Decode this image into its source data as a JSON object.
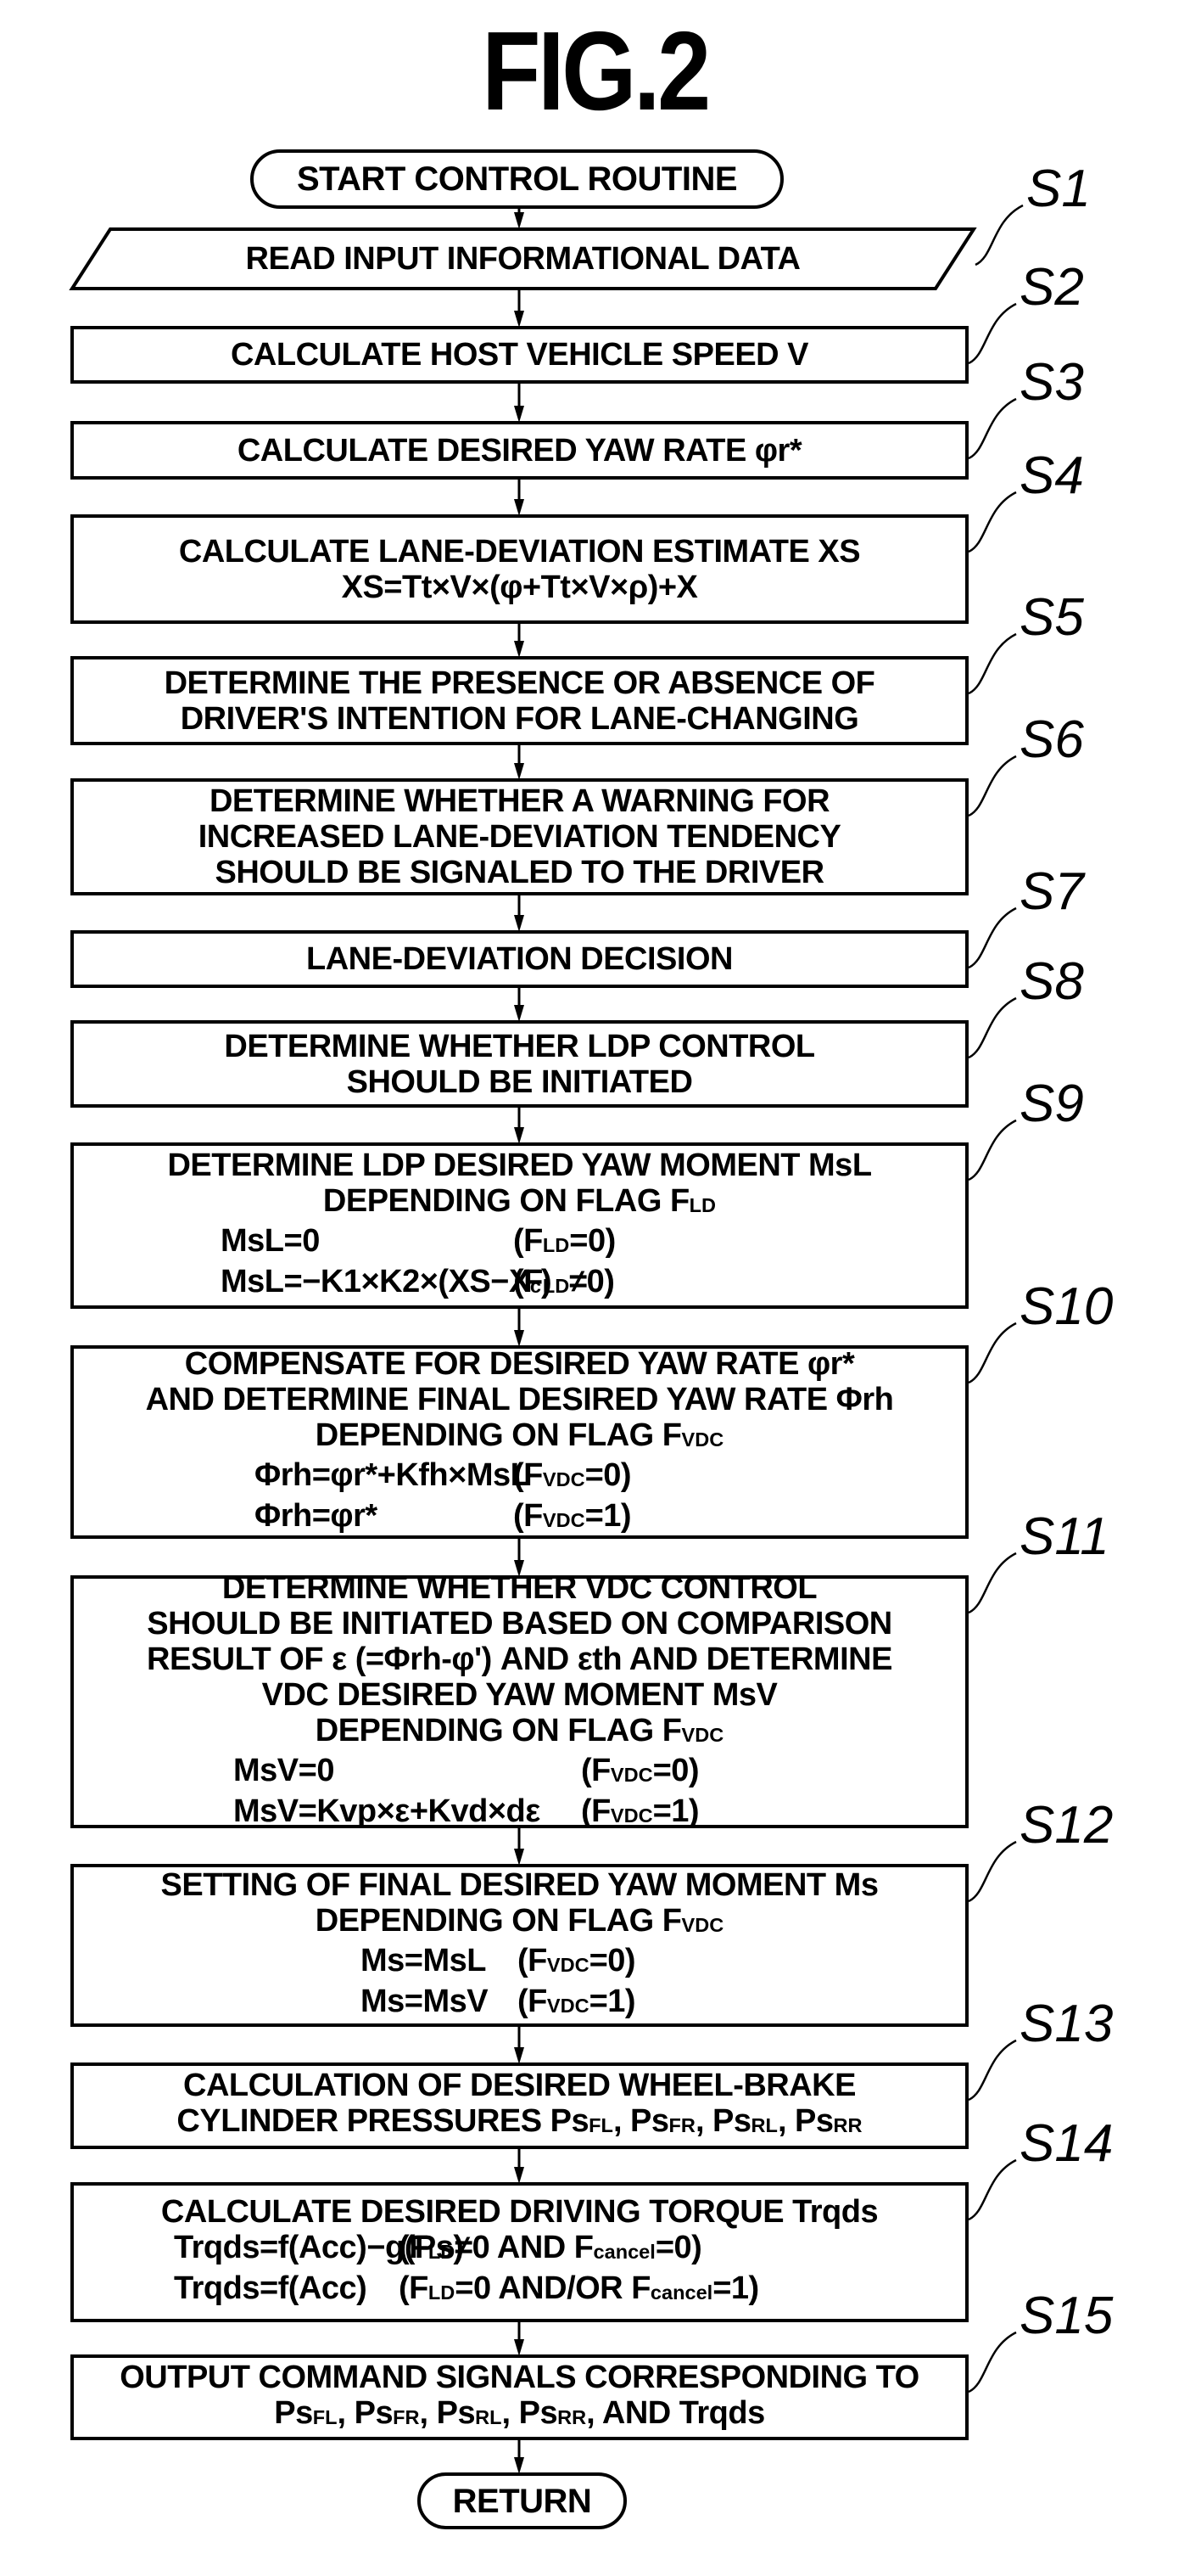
{
  "figure": {
    "title": "FIG.2"
  },
  "flowchart": {
    "start": "START CONTROL ROUTINE",
    "end": "RETURN",
    "steps": [
      {
        "id": "S1",
        "shape": "parallelogram",
        "lines": [
          "READ INPUT INFORMATIONAL DATA"
        ]
      },
      {
        "id": "S2",
        "shape": "rect",
        "lines": [
          "CALCULATE HOST VEHICLE SPEED V"
        ]
      },
      {
        "id": "S3",
        "shape": "rect",
        "lines": [
          "CALCULATE DESIRED YAW RATE φr*"
        ]
      },
      {
        "id": "S4",
        "shape": "rect",
        "lines": [
          "CALCULATE LANE-DEVIATION ESTIMATE XS",
          "XS=Tt×V×(φ+Tt×V×ρ)+X"
        ]
      },
      {
        "id": "S5",
        "shape": "rect",
        "lines": [
          "DETERMINE THE PRESENCE OR ABSENCE OF",
          "DRIVER'S INTENTION FOR LANE-CHANGING"
        ]
      },
      {
        "id": "S6",
        "shape": "rect",
        "lines": [
          "DETERMINE WHETHER A WARNING FOR",
          "INCREASED LANE-DEVIATION TENDENCY",
          "SHOULD BE SIGNALED TO THE DRIVER"
        ]
      },
      {
        "id": "S7",
        "shape": "rect",
        "lines": [
          "LANE-DEVIATION DECISION"
        ]
      },
      {
        "id": "S8",
        "shape": "rect",
        "lines": [
          "DETERMINE WHETHER LDP CONTROL",
          "SHOULD BE INITIATED"
        ]
      },
      {
        "id": "S9",
        "shape": "rect",
        "lines": [
          "DETERMINE LDP DESIRED YAW MOMENT MsL",
          "DEPENDING ON FLAG F_LD"
        ],
        "equations": [
          {
            "lhs": "MsL=0",
            "cond": "(F_LD=0)"
          },
          {
            "lhs": "MsL=−K1×K2×(XS−X_c)",
            "cond": "(F_LD≠0)"
          }
        ]
      },
      {
        "id": "S10",
        "shape": "rect",
        "lines": [
          "COMPENSATE FOR DESIRED YAW RATE φr*",
          "AND DETERMINE FINAL DESIRED YAW RATE Φrh",
          "DEPENDING ON FLAG F_VDC"
        ],
        "equations": [
          {
            "lhs": "Φrh=φr*+Kfh×MsL",
            "cond": "(F_VDC=0)"
          },
          {
            "lhs": "Φrh=φr*",
            "cond": "(F_VDC=1)"
          }
        ]
      },
      {
        "id": "S11",
        "shape": "rect",
        "lines": [
          "DETERMINE WHETHER VDC CONTROL",
          "SHOULD BE INITIATED BASED ON COMPARISON",
          "RESULT OF ε (=Φrh-φ') AND εth AND DETERMINE",
          "VDC DESIRED YAW MOMENT MsV",
          "DEPENDING ON FLAG F_VDC"
        ],
        "equations": [
          {
            "lhs": "MsV=0",
            "cond": "(F_VDC=0)"
          },
          {
            "lhs": "MsV=Kvp×ε+Kvd×dε",
            "cond": "(F_VDC=1)"
          }
        ]
      },
      {
        "id": "S12",
        "shape": "rect",
        "lines": [
          "SETTING OF FINAL DESIRED YAW MOMENT Ms",
          "DEPENDING ON FLAG F_VDC"
        ],
        "equations": [
          {
            "lhs": "Ms=MsL",
            "cond": "(F_VDC=0)"
          },
          {
            "lhs": "Ms=MsV",
            "cond": "(F_VDC=1)"
          }
        ]
      },
      {
        "id": "S13",
        "shape": "rect",
        "lines": [
          "CALCULATION OF DESIRED WHEEL-BRAKE",
          "CYLINDER PRESSURES Ps_FL, Ps_FR, Ps_RL, Ps_RR"
        ]
      },
      {
        "id": "S14",
        "shape": "rect",
        "lines": [
          "CALCULATE DESIRED DRIVING TORQUE Trqds"
        ],
        "equations": [
          {
            "lhs": "Trqds=f(Acc)−g(Ps)",
            "cond": "(F_LD≠0 AND F_cancel=0)"
          },
          {
            "lhs": "Trqds=f(Acc)",
            "cond": "(F_LD=0 AND/OR F_cancel=1)"
          }
        ]
      },
      {
        "id": "S15",
        "shape": "rect",
        "lines": [
          "OUTPUT COMMAND SIGNALS CORRESPONDING TO",
          "Ps_FL, Ps_FR, Ps_RL, Ps_RR, AND Trqds"
        ]
      }
    ]
  }
}
